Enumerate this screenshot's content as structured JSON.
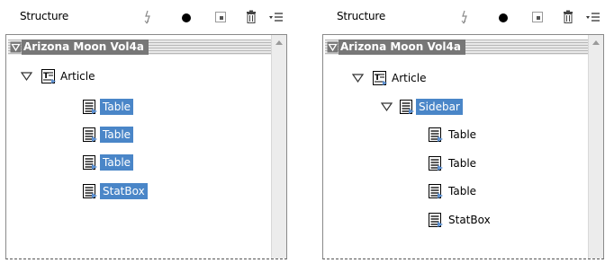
{
  "left_panel": {
    "title": "Structure",
    "root": "Arizona Moon Vol4a",
    "article": "Article",
    "items": [
      "Table",
      "Table",
      "Table",
      "StatBox"
    ]
  },
  "right_panel": {
    "title": "Structure",
    "root": "Arizona Moon Vol4a",
    "article": "Article",
    "sidebar": "Sidebar",
    "items": [
      "Table",
      "Table",
      "Table",
      "StatBox"
    ]
  },
  "colors": {
    "selection": "#4a86c8",
    "root_bar": "#777777"
  },
  "icons": [
    "lightning-icon",
    "circle-icon",
    "add-element-icon",
    "trash-icon",
    "panel-menu-icon",
    "expand-triangle-icon",
    "story-element-icon",
    "element-icon",
    "scroll-up-arrow-icon"
  ]
}
